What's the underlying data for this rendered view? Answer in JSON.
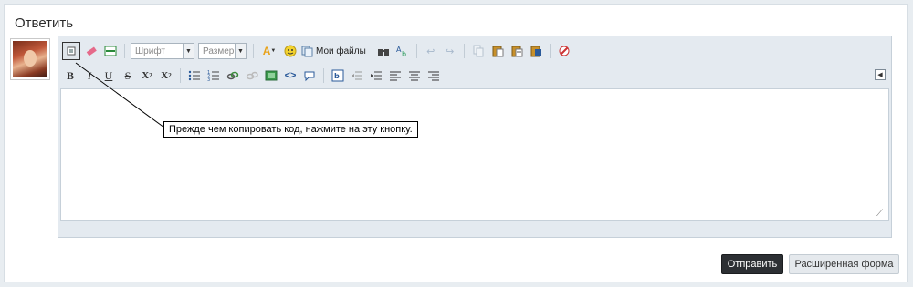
{
  "reply": {
    "title": "Ответить"
  },
  "toolbar": {
    "font_placeholder": "Шрифт",
    "size_placeholder": "Размер",
    "my_files": "Мои файлы"
  },
  "tooltip": {
    "text": "Прежде чем копировать код, нажмите на эту кнопку."
  },
  "buttons": {
    "send": "Отправить",
    "advanced": "Расширенная форма"
  },
  "colors": {
    "send_bg": "#2c2f33",
    "toolbar_bg": "#e4eaf0",
    "page_bg": "#e8edf1"
  }
}
